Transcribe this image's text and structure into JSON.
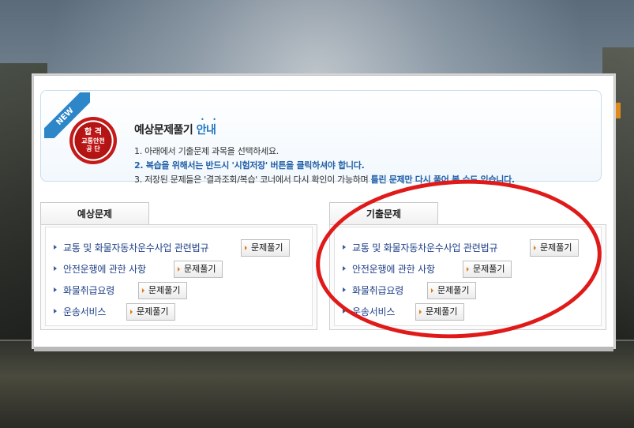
{
  "badge": {
    "new": "NEW",
    "seal_line1": "합 격",
    "seal_line2": "교통안전",
    "seal_line3": "공 단"
  },
  "info": {
    "title_main": "예상문제풀기",
    "title_accent": "안내",
    "line1": "1. 아래에서 기출문제 과목을 선택하세요.",
    "line2": "2. 복습을 위해서는 반드시 '시험저장' 버튼을 클릭하셔야 합니다.",
    "line3_prefix": "3. 저장된 문제들은 '결과조회/복습' 코너에서 다시 확인이 가능하며 ",
    "line3_highlight": "틀린 문제만 다시 풀어 볼 수도 있습니다."
  },
  "panels": {
    "left": {
      "tab_label": "예상문제",
      "items": [
        {
          "label": "교통 및 화물자동차운수사업 관련법규",
          "button": "문제풀기"
        },
        {
          "label": "안전운행에 관한 사항",
          "button": "문제풀기"
        },
        {
          "label": "화물취급요령",
          "button": "문제풀기"
        },
        {
          "label": "운송서비스",
          "button": "문제풀기"
        }
      ]
    },
    "right": {
      "tab_label": "기출문제",
      "items": [
        {
          "label": "교통 및 화물자동차운수사업 관련법규",
          "button": "문제풀기"
        },
        {
          "label": "안전운행에 관한 사항",
          "button": "문제풀기"
        },
        {
          "label": "화물취급요령",
          "button": "문제풀기"
        },
        {
          "label": "운송서비스",
          "button": "문제풀기"
        }
      ]
    }
  },
  "colors": {
    "accent_blue": "#2176c2",
    "link_navy": "#1e3f87",
    "highlight_red": "#e01919",
    "seal_red": "#c41a1a"
  }
}
